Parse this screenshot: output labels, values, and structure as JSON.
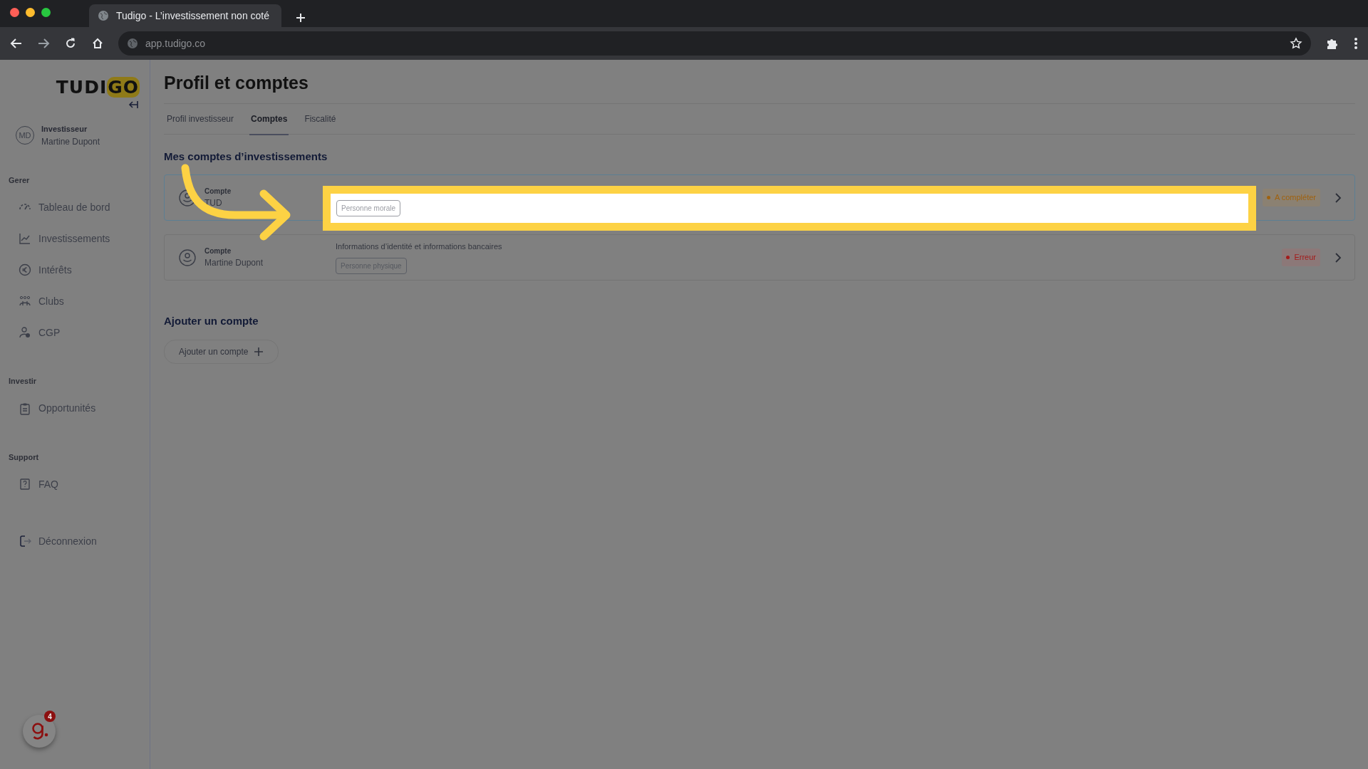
{
  "browser": {
    "tab_title": "Tudigo - L’investissement non coté",
    "url": "app.tudigo.co"
  },
  "sidebar": {
    "logo": {
      "first": "TUDI",
      "second": "GO"
    },
    "user": {
      "initials": "MD",
      "role": "Investisseur",
      "name": "Martine Dupont"
    },
    "sections": [
      {
        "title": "Gerer",
        "items": [
          {
            "label": "Tableau de bord"
          },
          {
            "label": "Investissements"
          },
          {
            "label": "Intérêts"
          },
          {
            "label": "Clubs"
          },
          {
            "label": "CGP"
          }
        ]
      },
      {
        "title": "Investir",
        "items": [
          {
            "label": "Opportunités"
          }
        ]
      },
      {
        "title": "Support",
        "items": [
          {
            "label": "FAQ"
          }
        ]
      }
    ],
    "logout": "Déconnexion",
    "widget_badge": "4"
  },
  "page": {
    "title": "Profil et comptes",
    "tabs": [
      {
        "label": "Profil investisseur",
        "selected": false
      },
      {
        "label": "Comptes",
        "selected": true
      },
      {
        "label": "Fiscalité",
        "selected": false
      }
    ],
    "accounts_heading": "Mes comptes d’investissements",
    "accounts": [
      {
        "label": "Compte",
        "name": "TUD",
        "tag": "Personne morale",
        "status": {
          "text": "A compléter",
          "kind": "warning"
        },
        "selected": true,
        "highlighted": true
      },
      {
        "label": "Compte",
        "name": "Martine Dupont",
        "info": "Informations d’identité et informations bancaires",
        "tag": "Personne physique",
        "status": {
          "text": "Erreur",
          "kind": "error"
        },
        "selected": false,
        "highlighted": false
      }
    ],
    "add_heading": "Ajouter un compte",
    "add_button": "Ajouter un compte"
  }
}
